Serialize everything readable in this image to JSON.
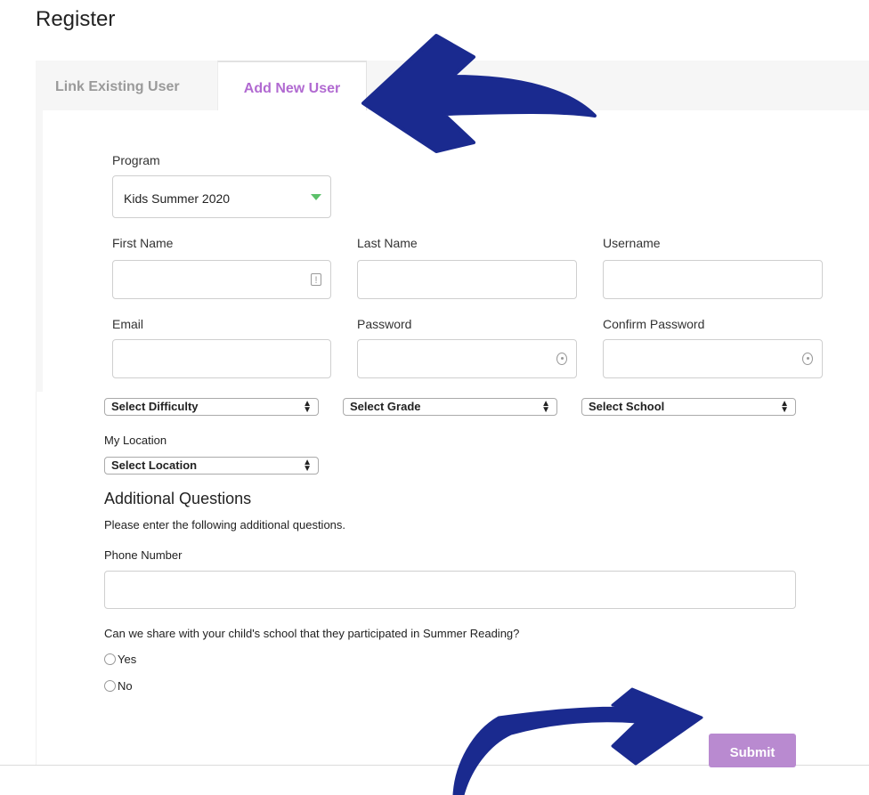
{
  "page": {
    "title": "Register"
  },
  "tabs": [
    {
      "label": "Link Existing User",
      "active": false
    },
    {
      "label": "Add New User",
      "active": true
    }
  ],
  "form": {
    "program": {
      "label": "Program",
      "value": "Kids Summer 2020"
    },
    "first_name": {
      "label": "First Name",
      "value": ""
    },
    "last_name": {
      "label": "Last Name",
      "value": ""
    },
    "username": {
      "label": "Username",
      "value": ""
    },
    "email": {
      "label": "Email",
      "value": ""
    },
    "password": {
      "label": "Password",
      "value": ""
    },
    "confirm_password": {
      "label": "Confirm Password",
      "value": ""
    },
    "difficulty": {
      "value": "Select Difficulty"
    },
    "grade": {
      "value": "Select Grade"
    },
    "school": {
      "value": "Select School"
    },
    "location": {
      "label": "My Location",
      "value": "Select Location"
    }
  },
  "additional": {
    "title": "Additional Questions",
    "description": "Please enter the following additional questions.",
    "phone": {
      "label": "Phone Number",
      "value": ""
    },
    "share_question": "Can we share with your child's school that they participated in Summer Reading?",
    "options": [
      "Yes",
      "No"
    ]
  },
  "submit_label": "Submit",
  "colors": {
    "accent": "#b16ad1",
    "submit_bg": "#b98ad0",
    "annotation_arrow": "#1a2a8f",
    "dropdown_triangle": "#5cc16a"
  },
  "icons": {
    "first_name_field": "key-icon",
    "password_field": "eye-icon"
  }
}
